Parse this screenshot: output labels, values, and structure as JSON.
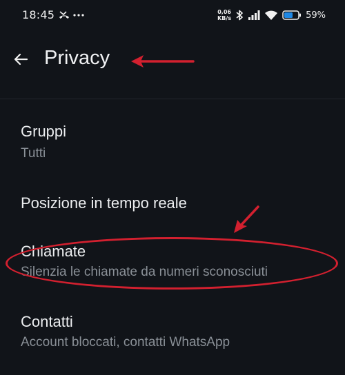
{
  "status_bar": {
    "time": "18:45",
    "net_speed_value": "0,06",
    "net_speed_unit": "KB/s",
    "battery_percent": "59%",
    "icons": [
      "missed-call-icon",
      "more-dots-icon",
      "bluetooth-icon",
      "signal-icon",
      "wifi-icon",
      "battery-icon"
    ]
  },
  "toolbar": {
    "title": "Privacy",
    "back_icon": "arrow-left-icon"
  },
  "settings": {
    "gruppi": {
      "title": "Gruppi",
      "subtitle": "Tutti"
    },
    "posizione": {
      "title": "Posizione in tempo reale"
    },
    "chiamate": {
      "title": "Chiamate",
      "subtitle": "Silenzia le chiamate da numeri sconosciuti"
    },
    "contatti": {
      "title": "Contatti",
      "subtitle": "Account bloccati, contatti WhatsApp"
    }
  },
  "annotations": {
    "color": "#d3202f",
    "items": [
      "red-arrow-to-title",
      "red-arrow-to-chiamate",
      "red-ellipse-around-chiamate"
    ]
  }
}
